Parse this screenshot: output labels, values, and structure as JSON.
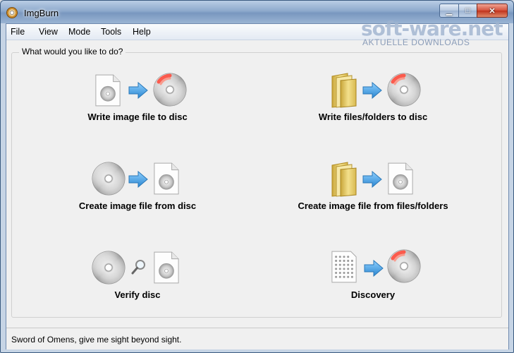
{
  "window": {
    "title": "ImgBurn"
  },
  "menu": [
    "File",
    "View",
    "Mode",
    "Tools",
    "Help"
  ],
  "watermark": {
    "main": "soft-ware.net",
    "sub": "AKTUELLE DOWNLOADS"
  },
  "group_label": "What would you like to do?",
  "actions": [
    {
      "label": "Write image file to disc",
      "icons": [
        "image-file-icon",
        "arrow-right-icon",
        "burn-disc-icon"
      ]
    },
    {
      "label": "Write files/folders to disc",
      "icons": [
        "folder-icon",
        "arrow-right-icon",
        "burn-disc-icon"
      ]
    },
    {
      "label": "Create image file from disc",
      "icons": [
        "disc-icon",
        "arrow-right-icon",
        "image-file-icon"
      ]
    },
    {
      "label": "Create image file from files/folders",
      "icons": [
        "folder-icon",
        "arrow-right-icon",
        "image-file-icon"
      ]
    },
    {
      "label": "Verify disc",
      "icons": [
        "disc-icon",
        "magnifier-icon",
        "image-file-icon"
      ]
    },
    {
      "label": "Discovery",
      "icons": [
        "discovery-pattern-icon",
        "arrow-right-icon",
        "burn-disc-icon"
      ]
    }
  ],
  "status": "Sword of Omens, give me sight beyond sight.",
  "colors": {
    "arrow": "#4aa3e0",
    "burn_ring": "#e03030",
    "folder": "#e8cf6e"
  }
}
